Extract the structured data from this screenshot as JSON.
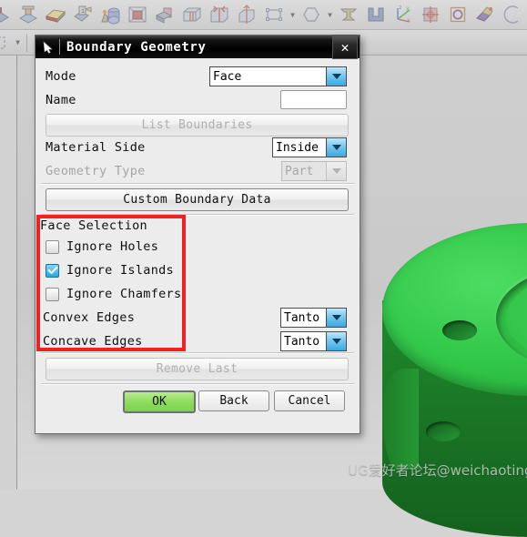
{
  "toolbar1": {
    "icons": [
      {
        "name": "partial-shape-icon"
      },
      {
        "name": "machining-fixture-icon"
      },
      {
        "name": "blank-stock-icon"
      },
      {
        "name": "part-info-icon"
      },
      {
        "name": "workpiece-icon"
      },
      {
        "name": "cube-solid-icon"
      },
      {
        "name": "plane-cut-icon"
      },
      {
        "name": "block-slot-icon"
      },
      {
        "name": "mirror-block-icon"
      },
      {
        "name": "translate-block-icon"
      },
      {
        "name": "rectangle-icon"
      },
      {
        "name": "chevron-down-icon"
      },
      {
        "name": "hexagon-icon"
      },
      {
        "name": "chevron-down-icon"
      },
      {
        "name": "i-beam-icon"
      },
      {
        "name": "u-channel-icon"
      },
      {
        "name": "csys-axes-icon"
      },
      {
        "name": "datum-target-icon"
      },
      {
        "name": "circle-in-square-icon"
      },
      {
        "name": "sketch-tool-icon"
      },
      {
        "name": "arc-icon"
      }
    ]
  },
  "toolbar2": {
    "icons": [
      {
        "name": "dashed-rectangle-icon"
      },
      {
        "name": "chevron-down-icon"
      },
      {
        "name": "solid-block-icon"
      }
    ]
  },
  "dialog": {
    "title": "Boundary Geometry",
    "title_icon": "cursor-arrow-icon",
    "close_label": "✕",
    "fields": {
      "mode_label": "Mode",
      "mode_value": "Face",
      "name_label": "Name",
      "name_value": "",
      "name_placeholder": "",
      "list_boundaries_label": "List Boundaries",
      "material_side_label": "Material Side",
      "material_side_value": "Inside",
      "geometry_type_label": "Geometry Type",
      "geometry_type_value": "Part",
      "custom_boundary_data_label": "Custom Boundary Data",
      "remove_last_label": "Remove Last"
    },
    "face_selection": {
      "group_label": "Face Selection",
      "highlight_color": "#ee2222",
      "checkboxes": [
        {
          "label": "Ignore Holes",
          "checked": false
        },
        {
          "label": "Ignore Islands",
          "checked": true
        },
        {
          "label": "Ignore Chamfers",
          "checked": false
        }
      ],
      "convex_edges_label": "Convex Edges",
      "convex_edges_value": "Tanto",
      "concave_edges_label": "Concave Edges",
      "concave_edges_value": "Tanto"
    },
    "actions": {
      "ok_label": "OK",
      "back_label": "Back",
      "cancel_label": "Cancel",
      "ok_color": "#8fdc5e"
    }
  },
  "viewport": {
    "part_color": "#33c94b",
    "background_color": "#cfcfcf",
    "watermark": "UG爱好者论坛@weichaoting"
  }
}
